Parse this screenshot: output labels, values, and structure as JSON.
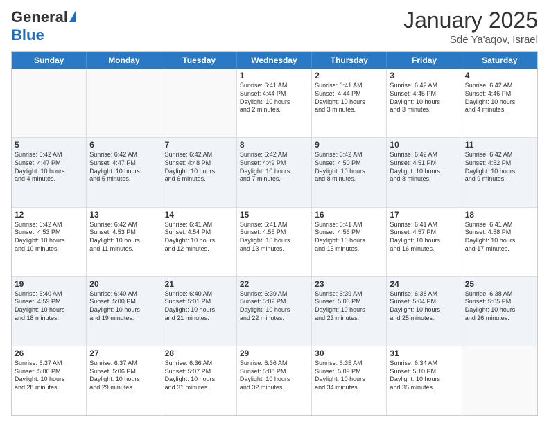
{
  "logo": {
    "general": "General",
    "blue": "Blue"
  },
  "header": {
    "month": "January 2025",
    "location": "Sde Ya'aqov, Israel"
  },
  "weekdays": [
    "Sunday",
    "Monday",
    "Tuesday",
    "Wednesday",
    "Thursday",
    "Friday",
    "Saturday"
  ],
  "rows": [
    [
      {
        "day": "",
        "text": ""
      },
      {
        "day": "",
        "text": ""
      },
      {
        "day": "",
        "text": ""
      },
      {
        "day": "1",
        "text": "Sunrise: 6:41 AM\nSunset: 4:44 PM\nDaylight: 10 hours\nand 2 minutes."
      },
      {
        "day": "2",
        "text": "Sunrise: 6:41 AM\nSunset: 4:44 PM\nDaylight: 10 hours\nand 3 minutes."
      },
      {
        "day": "3",
        "text": "Sunrise: 6:42 AM\nSunset: 4:45 PM\nDaylight: 10 hours\nand 3 minutes."
      },
      {
        "day": "4",
        "text": "Sunrise: 6:42 AM\nSunset: 4:46 PM\nDaylight: 10 hours\nand 4 minutes."
      }
    ],
    [
      {
        "day": "5",
        "text": "Sunrise: 6:42 AM\nSunset: 4:47 PM\nDaylight: 10 hours\nand 4 minutes."
      },
      {
        "day": "6",
        "text": "Sunrise: 6:42 AM\nSunset: 4:47 PM\nDaylight: 10 hours\nand 5 minutes."
      },
      {
        "day": "7",
        "text": "Sunrise: 6:42 AM\nSunset: 4:48 PM\nDaylight: 10 hours\nand 6 minutes."
      },
      {
        "day": "8",
        "text": "Sunrise: 6:42 AM\nSunset: 4:49 PM\nDaylight: 10 hours\nand 7 minutes."
      },
      {
        "day": "9",
        "text": "Sunrise: 6:42 AM\nSunset: 4:50 PM\nDaylight: 10 hours\nand 8 minutes."
      },
      {
        "day": "10",
        "text": "Sunrise: 6:42 AM\nSunset: 4:51 PM\nDaylight: 10 hours\nand 8 minutes."
      },
      {
        "day": "11",
        "text": "Sunrise: 6:42 AM\nSunset: 4:52 PM\nDaylight: 10 hours\nand 9 minutes."
      }
    ],
    [
      {
        "day": "12",
        "text": "Sunrise: 6:42 AM\nSunset: 4:53 PM\nDaylight: 10 hours\nand 10 minutes."
      },
      {
        "day": "13",
        "text": "Sunrise: 6:42 AM\nSunset: 4:53 PM\nDaylight: 10 hours\nand 11 minutes."
      },
      {
        "day": "14",
        "text": "Sunrise: 6:41 AM\nSunset: 4:54 PM\nDaylight: 10 hours\nand 12 minutes."
      },
      {
        "day": "15",
        "text": "Sunrise: 6:41 AM\nSunset: 4:55 PM\nDaylight: 10 hours\nand 13 minutes."
      },
      {
        "day": "16",
        "text": "Sunrise: 6:41 AM\nSunset: 4:56 PM\nDaylight: 10 hours\nand 15 minutes."
      },
      {
        "day": "17",
        "text": "Sunrise: 6:41 AM\nSunset: 4:57 PM\nDaylight: 10 hours\nand 16 minutes."
      },
      {
        "day": "18",
        "text": "Sunrise: 6:41 AM\nSunset: 4:58 PM\nDaylight: 10 hours\nand 17 minutes."
      }
    ],
    [
      {
        "day": "19",
        "text": "Sunrise: 6:40 AM\nSunset: 4:59 PM\nDaylight: 10 hours\nand 18 minutes."
      },
      {
        "day": "20",
        "text": "Sunrise: 6:40 AM\nSunset: 5:00 PM\nDaylight: 10 hours\nand 19 minutes."
      },
      {
        "day": "21",
        "text": "Sunrise: 6:40 AM\nSunset: 5:01 PM\nDaylight: 10 hours\nand 21 minutes."
      },
      {
        "day": "22",
        "text": "Sunrise: 6:39 AM\nSunset: 5:02 PM\nDaylight: 10 hours\nand 22 minutes."
      },
      {
        "day": "23",
        "text": "Sunrise: 6:39 AM\nSunset: 5:03 PM\nDaylight: 10 hours\nand 23 minutes."
      },
      {
        "day": "24",
        "text": "Sunrise: 6:38 AM\nSunset: 5:04 PM\nDaylight: 10 hours\nand 25 minutes."
      },
      {
        "day": "25",
        "text": "Sunrise: 6:38 AM\nSunset: 5:05 PM\nDaylight: 10 hours\nand 26 minutes."
      }
    ],
    [
      {
        "day": "26",
        "text": "Sunrise: 6:37 AM\nSunset: 5:06 PM\nDaylight: 10 hours\nand 28 minutes."
      },
      {
        "day": "27",
        "text": "Sunrise: 6:37 AM\nSunset: 5:06 PM\nDaylight: 10 hours\nand 29 minutes."
      },
      {
        "day": "28",
        "text": "Sunrise: 6:36 AM\nSunset: 5:07 PM\nDaylight: 10 hours\nand 31 minutes."
      },
      {
        "day": "29",
        "text": "Sunrise: 6:36 AM\nSunset: 5:08 PM\nDaylight: 10 hours\nand 32 minutes."
      },
      {
        "day": "30",
        "text": "Sunrise: 6:35 AM\nSunset: 5:09 PM\nDaylight: 10 hours\nand 34 minutes."
      },
      {
        "day": "31",
        "text": "Sunrise: 6:34 AM\nSunset: 5:10 PM\nDaylight: 10 hours\nand 35 minutes."
      },
      {
        "day": "",
        "text": ""
      }
    ]
  ]
}
